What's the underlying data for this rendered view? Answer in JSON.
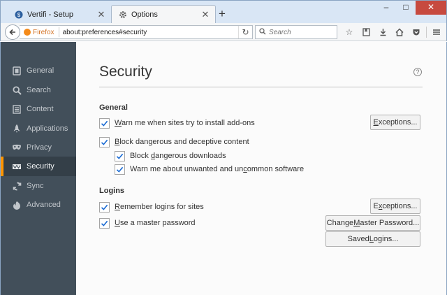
{
  "tabs": [
    {
      "title": "Vertifi - Setup",
      "icon": "vertifi-icon",
      "active": false
    },
    {
      "title": "Options",
      "icon": "gear-icon",
      "active": true
    }
  ],
  "window": {
    "minimize": "–",
    "maximize": "□",
    "close": "✕"
  },
  "navbar": {
    "identity_label": "Firefox",
    "url": "about:preferences#security",
    "search_placeholder": "Search"
  },
  "sidebar": {
    "items": [
      {
        "label": "General",
        "icon": "general-icon"
      },
      {
        "label": "Search",
        "icon": "search-icon"
      },
      {
        "label": "Content",
        "icon": "content-icon"
      },
      {
        "label": "Applications",
        "icon": "applications-icon"
      },
      {
        "label": "Privacy",
        "icon": "privacy-mask-icon"
      },
      {
        "label": "Security",
        "icon": "security-icon",
        "selected": true
      },
      {
        "label": "Sync",
        "icon": "sync-icon"
      },
      {
        "label": "Advanced",
        "icon": "advanced-icon"
      }
    ]
  },
  "main": {
    "title": "Security",
    "general": {
      "heading": "General",
      "warn_addons": {
        "pre": "",
        "u": "W",
        "post": "arn me when sites try to install add-ons",
        "checked": true
      },
      "block_deceptive": {
        "pre": "",
        "u": "B",
        "post": "lock dangerous and deceptive content",
        "checked": true
      },
      "block_downloads": {
        "pre": "Block ",
        "u": "d",
        "post": "angerous downloads",
        "checked": true
      },
      "warn_unwanted": {
        "pre": "Warn me about unwanted and un",
        "u": "c",
        "post": "ommon software",
        "checked": true
      },
      "exceptions_btn": {
        "pre": "",
        "u": "E",
        "post": "xceptions..."
      }
    },
    "logins": {
      "heading": "Logins",
      "remember": {
        "pre": "",
        "u": "R",
        "post": "emember logins for sites",
        "checked": true
      },
      "master": {
        "pre": "",
        "u": "U",
        "post": "se a master password",
        "checked": true
      },
      "exceptions_btn": {
        "pre": "E",
        "u": "x",
        "post": "ceptions..."
      },
      "change_master_btn": {
        "pre": "Change ",
        "u": "M",
        "post": "aster Password..."
      },
      "saved_logins_btn": {
        "pre": "Saved ",
        "u": "L",
        "post": "ogins..."
      }
    }
  },
  "colors": {
    "accent": "#ff9500",
    "sidebar": "#424f5a",
    "sidebar_selected": "#343f48",
    "checkmark": "#1a6bd4"
  }
}
